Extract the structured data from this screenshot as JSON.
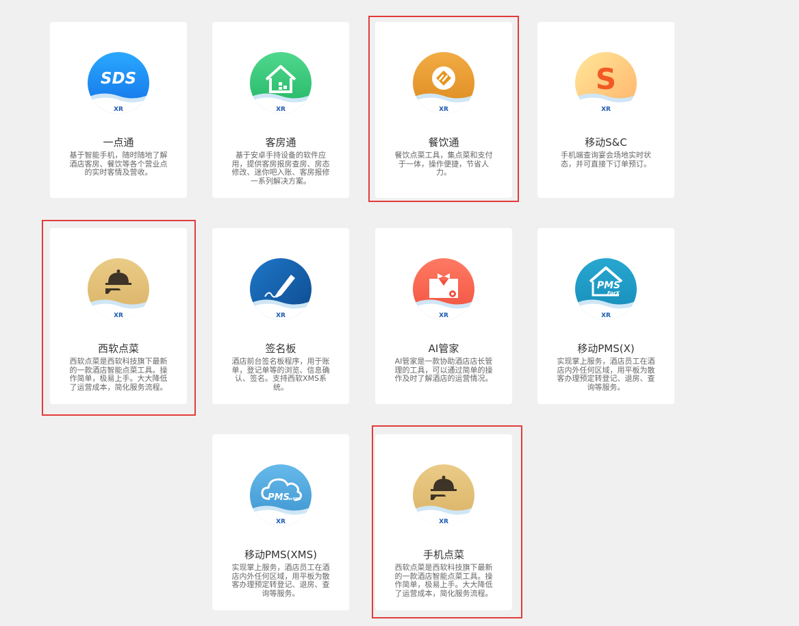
{
  "badge_text": "XR",
  "colors": {
    "highlight_border": "#e23b3b",
    "card_bg": "#ffffff",
    "page_bg": "#f0f0f0"
  },
  "cards": [
    {
      "icon": "sds-icon",
      "icon_text": "SDS",
      "title": "一点通",
      "desc": "基于智能手机，随时随地了解酒店客房、餐饮等各个营业点的实时客情及营收。"
    },
    {
      "icon": "house-qr-icon",
      "title": "客房通",
      "desc": "基于安卓手持设备的软件应用，提供客房报房查房、房态修改、迷你吧入账、客房报修一系列解决方案。"
    },
    {
      "icon": "restaurant-diamond-icon",
      "title": "餐饮通",
      "desc": "餐饮点菜工具，集点菜和支付于一体，操作便捷，节省人力。"
    },
    {
      "icon": "s-letter-icon",
      "icon_text": "S",
      "title": "移动S&C",
      "desc": "手机端查询宴会场地实时状态，并可直接下订单预订。"
    },
    {
      "icon": "cloche-hand-icon",
      "title": "西软点菜",
      "desc": "西软点菜是西软科技旗下最新的一款酒店智能点菜工具。操作简单，极易上手。大大降低了运营成本，简化服务流程。"
    },
    {
      "icon": "signature-pen-icon",
      "title": "签名板",
      "desc": "酒店前台签名板程序，用于账单，登记单等的浏览、信息确认、签名。支持西软XMS系统。"
    },
    {
      "icon": "butler-icon",
      "title": "AI管家",
      "desc": "AI管家是一款协助酒店店长管理的工具，可以通过简单的操作及时了解酒店的运营情况。"
    },
    {
      "icon": "pms-house-icon",
      "icon_text": "PMS",
      "icon_subtext": "ForX",
      "title": "移动PMS(X)",
      "desc": "实现掌上服务，酒店员工在酒店内外任何区域，用平板为散客办理预定转登记、退房、查询等服务。"
    },
    {
      "icon": "pms-cloud-icon",
      "icon_text": "PMS",
      "icon_subtext": "ForXMS",
      "title": "移动PMS(XMS)",
      "desc": "实现掌上服务，酒店员工在酒店内外任何区域，用平板为散客办理预定转登记、退房、查询等服务。"
    },
    {
      "icon": "cloche-hand-icon",
      "title": "手机点菜",
      "desc": "西软点菜是西软科技旗下最新的一款酒店智能点菜工具。操作简单，极易上手。大大降低了运营成本，简化服务流程。"
    }
  ]
}
